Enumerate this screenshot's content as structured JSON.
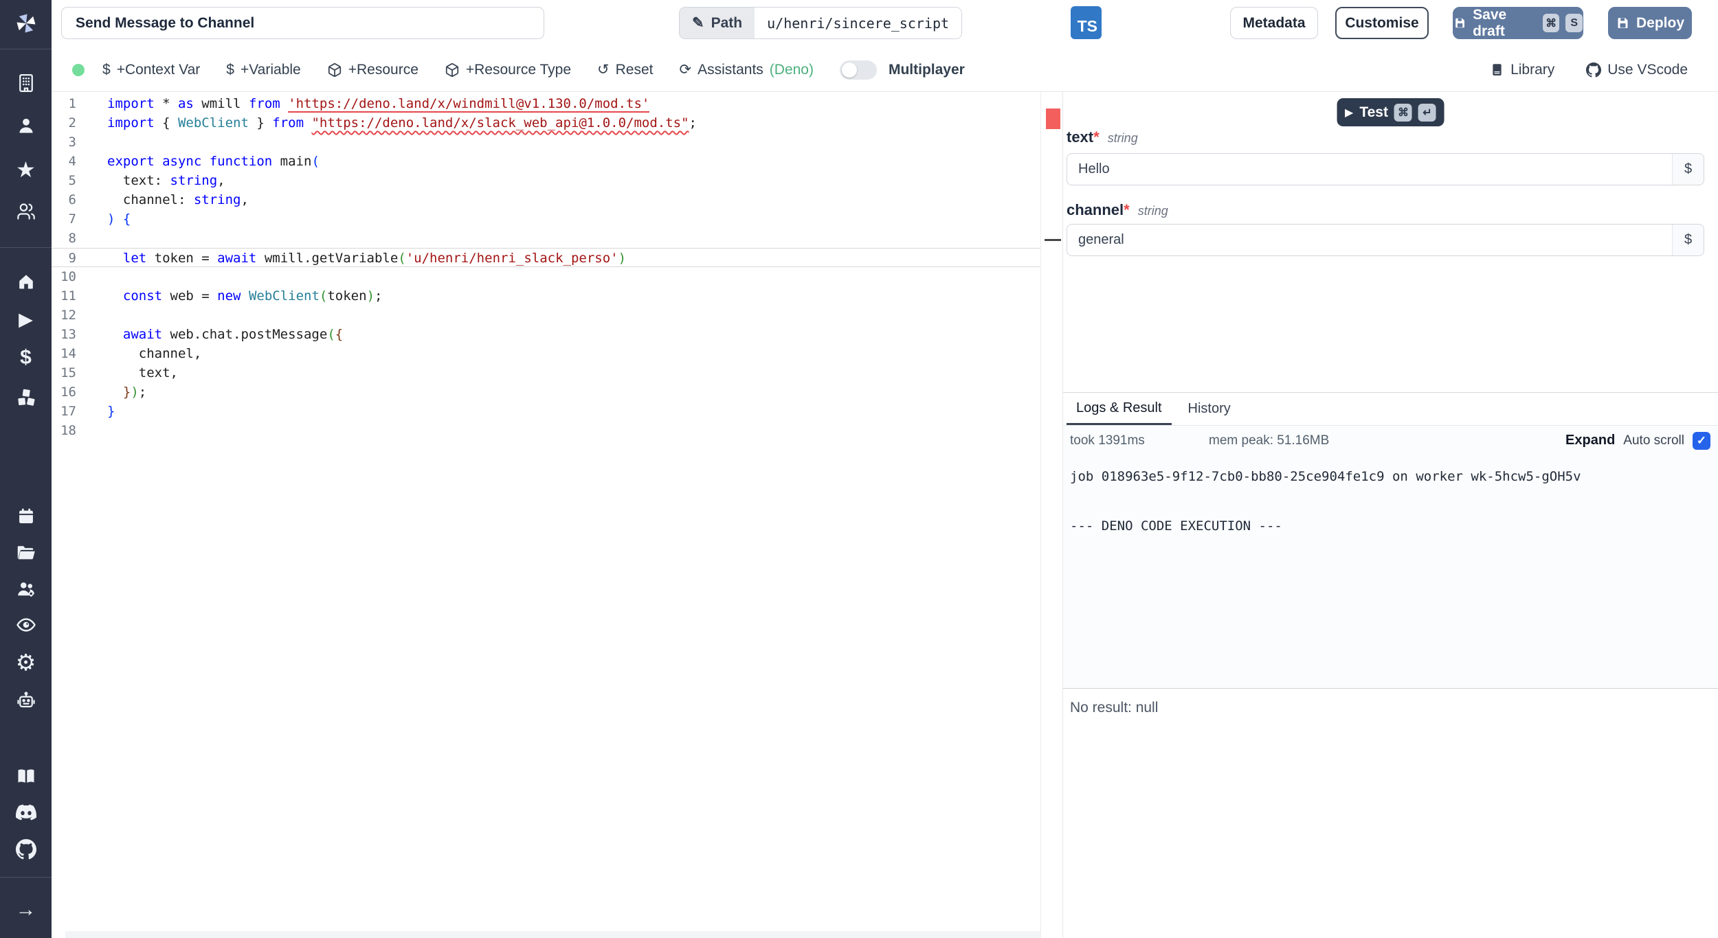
{
  "colors": {
    "sidebar_bg": "#2d3344",
    "primary_button_blue": "#60799f",
    "ts_badge_blue": "#3178c6",
    "checkbox_blue": "#2563eb",
    "status_green_dot": "#74dd9b",
    "assistants_green": "#4caf7d",
    "error_red": "#f25f5c"
  },
  "icons": {
    "pencil": "✎",
    "star": "★",
    "play": "▶",
    "dollar": "$",
    "gear": "⚙",
    "arrow_right": "→",
    "check": "✓",
    "cmd": "⌘",
    "enter": "↵",
    "reset": "↺",
    "assistants_refresh": "⟳"
  },
  "sidebar": {
    "icon_names": [
      "windmill-logo",
      "building",
      "user",
      "star",
      "users",
      "home",
      "play",
      "dollar",
      "cubes",
      "calendar",
      "folder",
      "users-gear",
      "eye",
      "gear",
      "robot",
      "book",
      "discord",
      "github",
      "arrow-right"
    ]
  },
  "header": {
    "title_value": "Send Message to Channel",
    "path_label": "Path",
    "path_value": "u/henri/sincere_script",
    "lang_badge": "TS",
    "metadata_label": "Metadata",
    "customise_label": "Customise",
    "save_draft_label": "Save draft",
    "save_key": "S",
    "deploy_label": "Deploy"
  },
  "toolbar": {
    "context_var": "+Context Var",
    "variable": "+Variable",
    "resource": "+Resource",
    "resource_type": "+Resource Type",
    "reset": "Reset",
    "assistants": "Assistants",
    "assistants_lang": "(Deno)",
    "multiplayer": "Multiplayer",
    "library": "Library",
    "use_vscode": "Use VScode"
  },
  "editor": {
    "current_line": 9,
    "lines": [
      [
        [
          "kw",
          "import "
        ],
        [
          "pl",
          "* "
        ],
        [
          "kw",
          "as "
        ],
        [
          "pl",
          "wmill "
        ],
        [
          "kw",
          "from "
        ],
        [
          "str u1",
          "'https://deno.land/x/windmill@v1.130.0/mod.ts'"
        ]
      ],
      [
        [
          "kw",
          "import "
        ],
        [
          "pl",
          "{ "
        ],
        [
          "cls",
          "WebClient"
        ],
        [
          "pl",
          " } "
        ],
        [
          "kw",
          "from "
        ],
        [
          "str u2",
          "\"https://deno.land/x/slack_web_api@1.0.0/mod.ts\""
        ],
        [
          "pl",
          ";"
        ]
      ],
      [],
      [
        [
          "kw",
          "export async function "
        ],
        [
          "pl",
          "main"
        ],
        [
          "b1",
          "("
        ]
      ],
      [
        [
          "pl",
          "  text: "
        ],
        [
          "kw",
          "string"
        ],
        [
          "pl",
          ","
        ]
      ],
      [
        [
          "pl",
          "  channel: "
        ],
        [
          "kw",
          "string"
        ],
        [
          "pl",
          ","
        ]
      ],
      [
        [
          "b1",
          ") {"
        ]
      ],
      [],
      [
        [
          "pl",
          "  "
        ],
        [
          "kw",
          "let"
        ],
        [
          "pl",
          " token = "
        ],
        [
          "kw",
          "await"
        ],
        [
          "pl",
          " wmill.getVariable"
        ],
        [
          "b2",
          "("
        ],
        [
          "str",
          "'u/henri/henri_slack_perso'"
        ],
        [
          "b2",
          ")"
        ]
      ],
      [],
      [
        [
          "pl",
          "  "
        ],
        [
          "kw",
          "const"
        ],
        [
          "pl",
          " web = "
        ],
        [
          "kw",
          "new"
        ],
        [
          "pl",
          " "
        ],
        [
          "cls",
          "WebClient"
        ],
        [
          "b2",
          "("
        ],
        [
          "pl",
          "token"
        ],
        [
          "b2",
          ")"
        ],
        [
          "pl",
          ";"
        ]
      ],
      [],
      [
        [
          "pl",
          "  "
        ],
        [
          "kw",
          "await"
        ],
        [
          "pl",
          " web.chat.postMessage"
        ],
        [
          "b2",
          "("
        ],
        [
          "b3",
          "{"
        ]
      ],
      [
        [
          "pl",
          "    channel,"
        ]
      ],
      [
        [
          "pl",
          "    text,"
        ]
      ],
      [
        [
          "pl",
          "  "
        ],
        [
          "b3",
          "}"
        ],
        [
          "b2",
          ")"
        ],
        [
          "pl",
          ";"
        ]
      ],
      [
        [
          "b1",
          "}"
        ]
      ],
      []
    ]
  },
  "run": {
    "test_label": "Test"
  },
  "form": {
    "required_mark": "*",
    "var_button": "$",
    "fields": [
      {
        "name": "text",
        "type": "string",
        "value": "Hello"
      },
      {
        "name": "channel",
        "type": "string",
        "value": "general"
      }
    ]
  },
  "logs": {
    "tab_logs": "Logs & Result",
    "tab_history": "History",
    "took": "took 1391ms",
    "mem": "mem peak: 51.16MB",
    "expand": "Expand",
    "autoscroll": "Auto scroll",
    "text": "job 018963e5-9f12-7cb0-bb80-25ce904fe1c9 on worker wk-5hcw5-gOH5v\n\n\n--- DENO CODE EXECUTION ---",
    "result": "No result: null"
  }
}
